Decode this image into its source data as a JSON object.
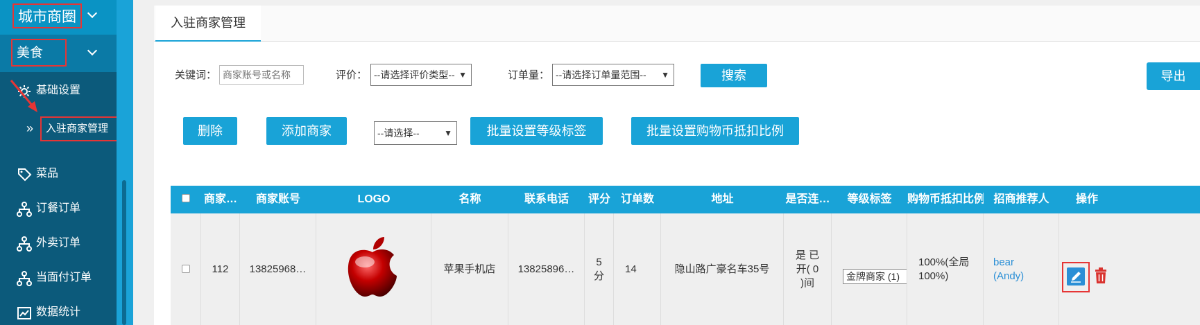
{
  "sidebar": {
    "top": {
      "label": "城市商圈"
    },
    "sub": {
      "label": "美食"
    },
    "items": [
      {
        "label": "基础设置",
        "icon": "gear-icon"
      },
      {
        "label": "入驻商家管理",
        "icon": "double-chevron-icon"
      },
      {
        "label": "菜品",
        "icon": "tag-icon"
      },
      {
        "label": "订餐订单",
        "icon": "sitemap-icon"
      },
      {
        "label": "外卖订单",
        "icon": "sitemap-icon"
      },
      {
        "label": "当面付订单",
        "icon": "sitemap-icon"
      },
      {
        "label": "数据统计",
        "icon": "chart-icon"
      }
    ]
  },
  "tabs": [
    {
      "label": "入驻商家管理"
    }
  ],
  "filters": {
    "keyword_label": "关键词：",
    "keyword_placeholder": "商家账号或名称",
    "rating_label": "评价：",
    "rating_value": "--请选择评价类型--",
    "orders_label": "订单量：",
    "orders_value": "--请选择订单量范围--",
    "search_label": "搜索",
    "export_label": "导出"
  },
  "actions": {
    "delete_label": "删除",
    "add_label": "添加商家",
    "select_value": "--请选择--",
    "batch_grade_label": "批量设置等级标签",
    "batch_ratio_label": "批量设置购物币抵扣比例"
  },
  "table": {
    "headers": [
      "商家…",
      "商家账号",
      "LOGO",
      "名称",
      "联系电话",
      "评分",
      "订单数",
      "地址",
      "是否连…",
      "等级标签",
      "购物币抵扣比例",
      "招商推荐人",
      "操作"
    ],
    "rows": [
      {
        "id": "112",
        "account": "13825968…",
        "name": "苹果手机店",
        "phone": "13825896…",
        "rating_1": "5",
        "rating_2": "分",
        "orders": "14",
        "address": "隐山路广豪名车35号",
        "chain_1": "是 已",
        "chain_2": "开( 0",
        "chain_3": ")间",
        "grade": "金牌商家 (1)",
        "ratio_1": "100%(全局",
        "ratio_2": "100%)",
        "referrer_1": "bear",
        "referrer_2": "(Andy)"
      }
    ]
  },
  "colors": {
    "accent": "#19a3d7",
    "sidebar": "#0c5a7b",
    "highlight": "#e63535"
  }
}
